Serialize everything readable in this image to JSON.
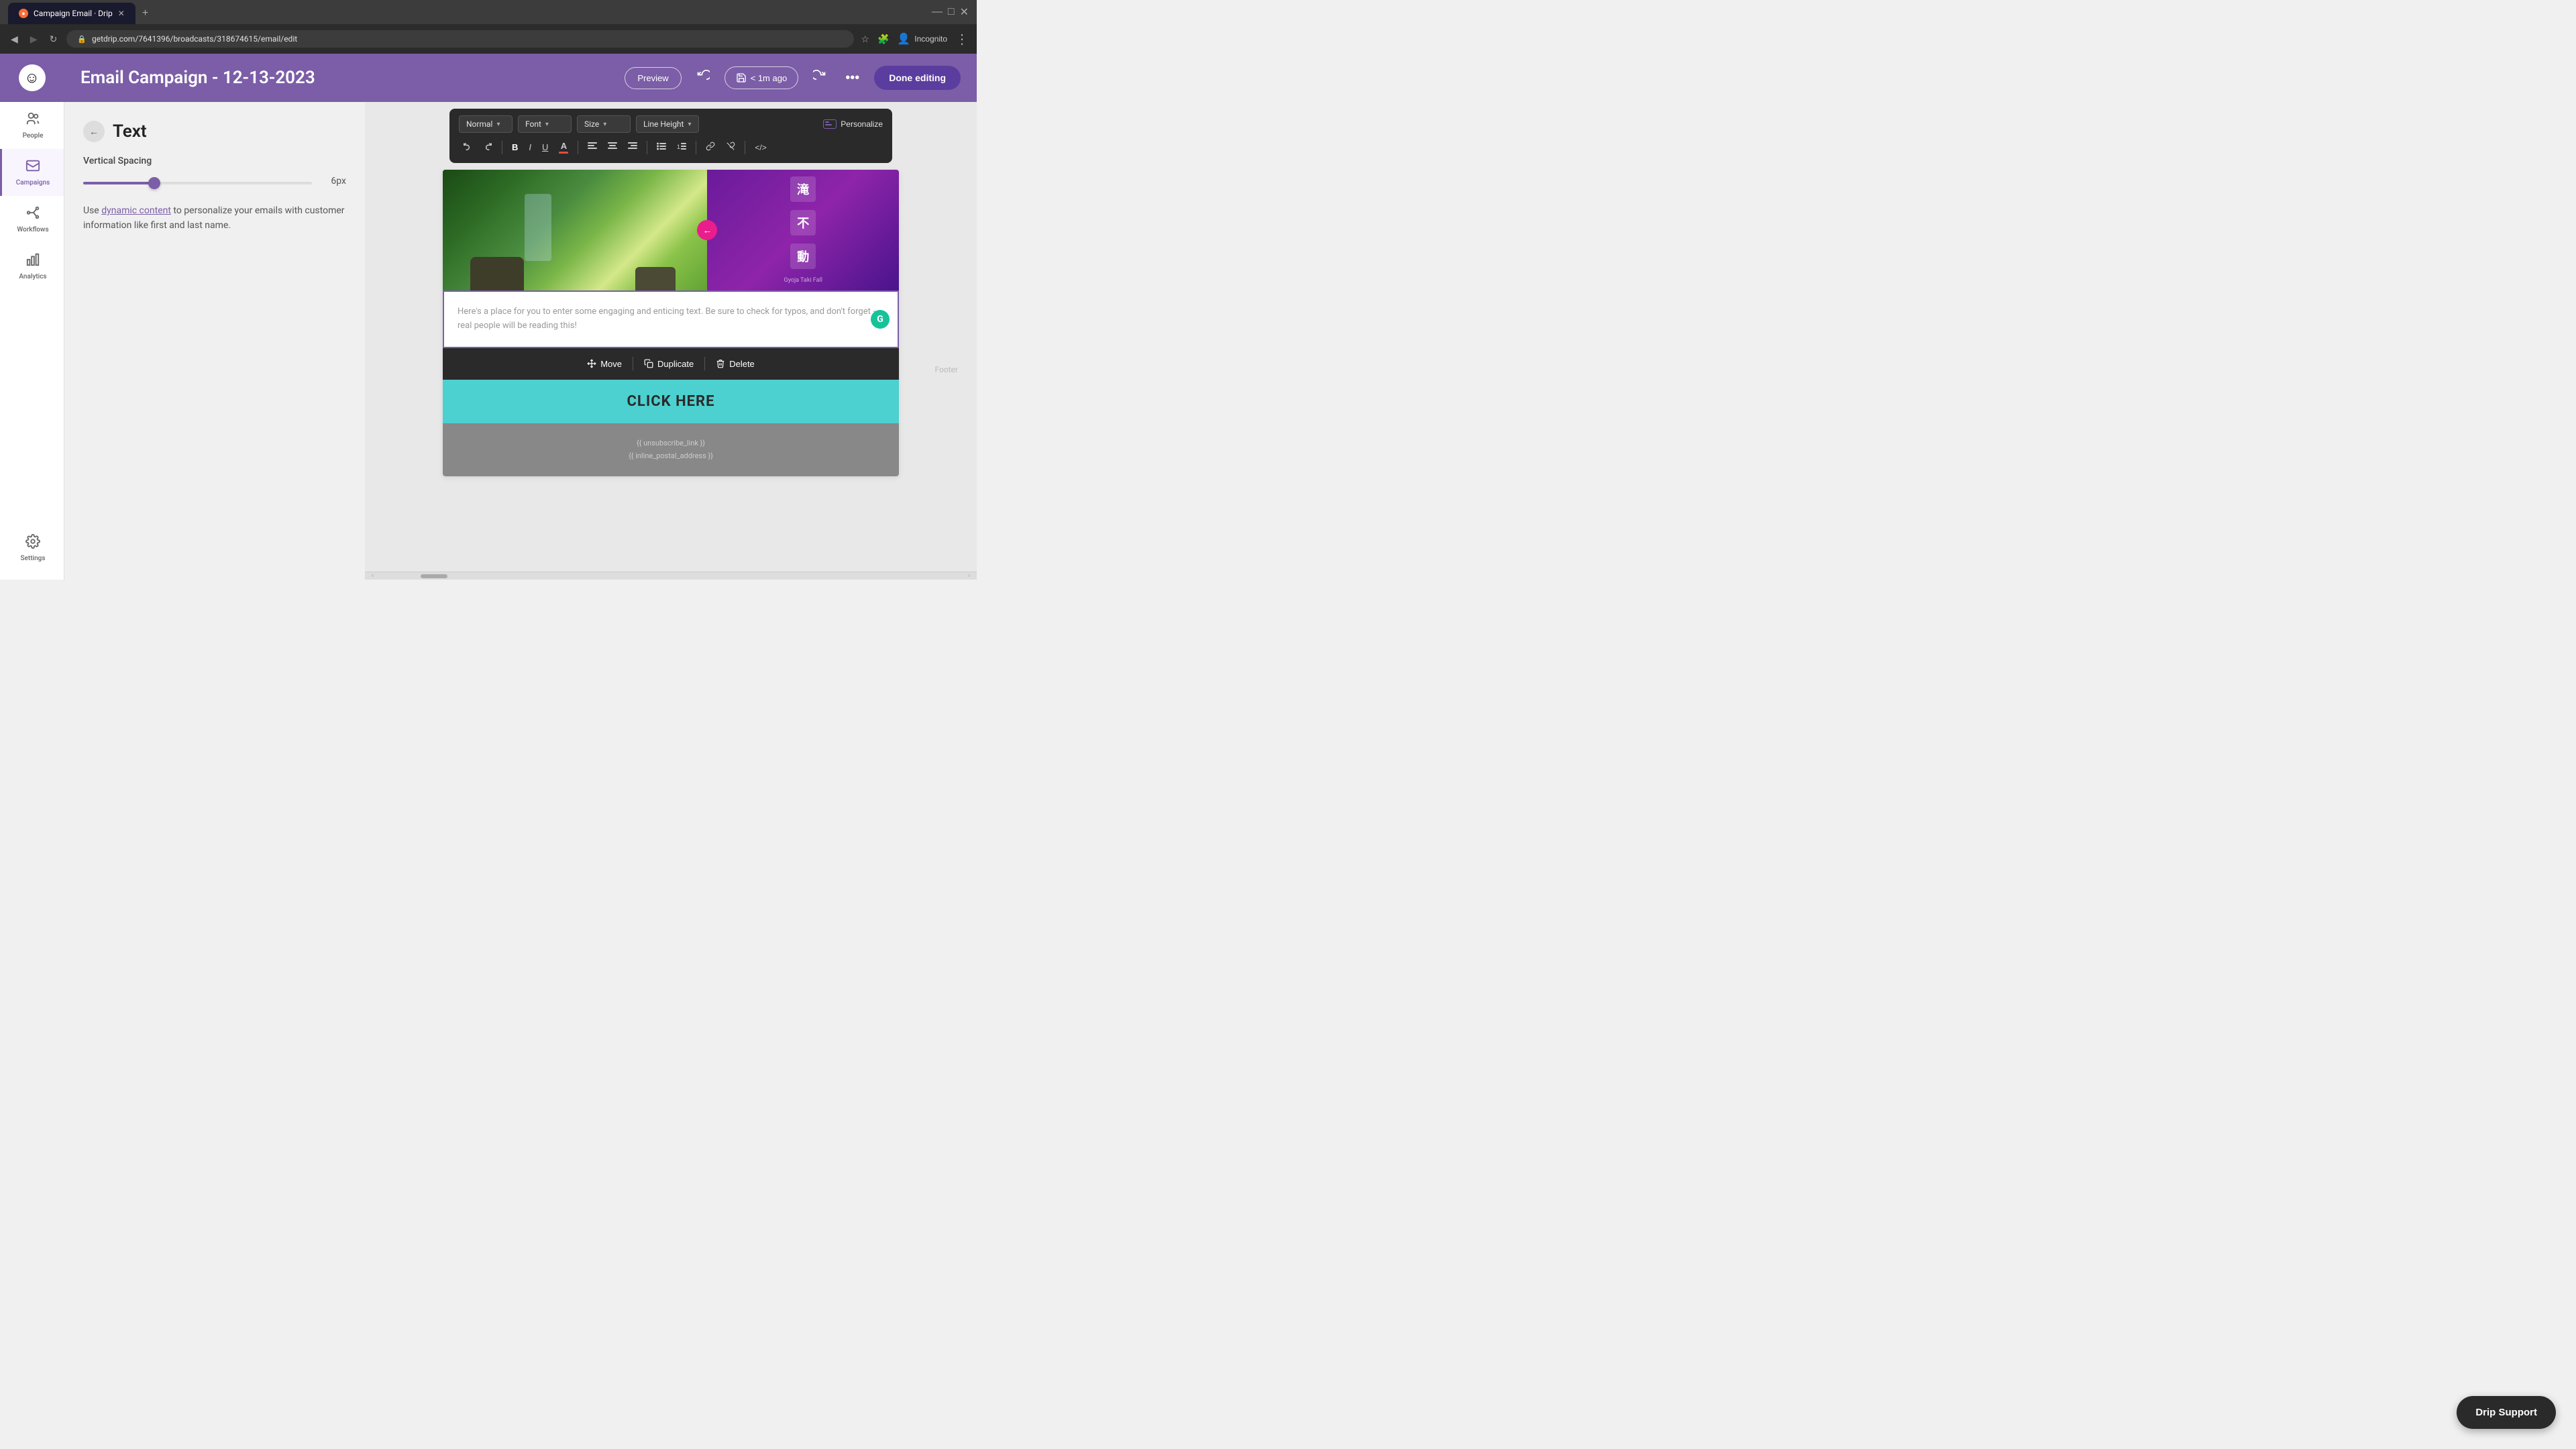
{
  "browser": {
    "tab_title": "Campaign Email · Drip",
    "new_tab_label": "+",
    "address": "getdrip.com/7641396/broadcasts/318674615/email/edit",
    "incognito_label": "Incognito",
    "window_controls": [
      "—",
      "□",
      "×"
    ]
  },
  "app_logo": "☺",
  "nav": {
    "items": [
      {
        "id": "people",
        "label": "People",
        "icon": "👤",
        "active": false
      },
      {
        "id": "campaigns",
        "label": "Campaigns",
        "icon": "📧",
        "active": true
      },
      {
        "id": "workflows",
        "label": "Workflows",
        "icon": "⚙",
        "active": false
      },
      {
        "id": "analytics",
        "label": "Analytics",
        "icon": "📊",
        "active": false
      },
      {
        "id": "settings",
        "label": "Settings",
        "icon": "⚙",
        "active": false
      }
    ]
  },
  "header": {
    "title": "Email Campaign - 12-13-2023",
    "preview_btn": "Preview",
    "save_label": "< 1m ago",
    "more_btn": "•••",
    "done_btn": "Done editing"
  },
  "left_panel": {
    "title": "Text",
    "section_label": "Vertical Spacing",
    "slider_value": "6px",
    "description_text": "Use dynamic content to personalize your emails with customer information like first and last name.",
    "dynamic_content_link": "dynamic content"
  },
  "formatting_toolbar": {
    "style_dropdown": "Normal",
    "font_dropdown": "Font",
    "size_dropdown": "Size",
    "line_height_dropdown": "Line Height",
    "personalize_btn": "Personalize",
    "buttons": [
      "←",
      "→",
      "B",
      "I",
      "U",
      "A",
      "≡",
      "≡",
      "≡",
      "≡",
      "≡",
      "🔗",
      "🔗",
      "</>"
    ]
  },
  "email": {
    "text_placeholder": "Here's a place for you to enter some engaging and enticing text. Be sure to check for typos, and don't forget -- real people will be reading this!",
    "action_bar": {
      "move_btn": "Move",
      "duplicate_btn": "Duplicate",
      "delete_btn": "Delete"
    },
    "cta_text": "Click Here",
    "footer": {
      "unsubscribe": "{{ unsubscribe_link }}",
      "postal": "{{ inline_postal_address }}"
    }
  },
  "right_panel": {
    "footer_label": "Footer"
  },
  "drip_support_btn": "Drip Support"
}
